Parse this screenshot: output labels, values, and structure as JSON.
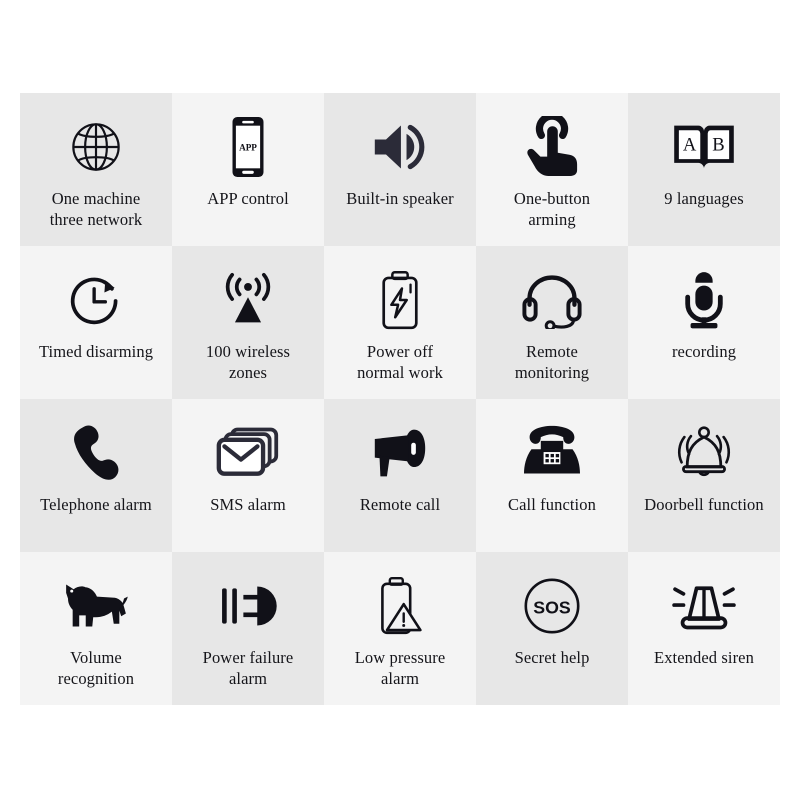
{
  "page": {
    "background_color": "#ffffff",
    "grid_shade_a": "#e7e7e7",
    "grid_shade_b": "#f4f4f4",
    "icon_color": "#111118",
    "text_color": "#15151a",
    "columns": 5,
    "rows": 4
  },
  "features": [
    {
      "label": "One machine\nthree network",
      "icon": "globe-icon"
    },
    {
      "label": "APP control",
      "icon": "smartphone-app-icon",
      "icon_text": "APP"
    },
    {
      "label": "Built-in speaker",
      "icon": "speaker-volume-icon"
    },
    {
      "label": "One-button\narming",
      "icon": "finger-tap-button-icon"
    },
    {
      "label": "9 languages",
      "icon": "open-book-icon",
      "icon_text": "A B"
    },
    {
      "label": "Timed disarming",
      "icon": "clock-arrow-icon"
    },
    {
      "label": "100 wireless\nzones",
      "icon": "antenna-signal-icon"
    },
    {
      "label": "Power off\nnormal work",
      "icon": "battery-bolt-icon"
    },
    {
      "label": "Remote\nmonitoring",
      "icon": "headset-icon"
    },
    {
      "label": "recording",
      "icon": "microphone-icon"
    },
    {
      "label": "Telephone alarm",
      "icon": "phone-handset-icon"
    },
    {
      "label": "SMS alarm",
      "icon": "envelope-stack-icon"
    },
    {
      "label": "Remote call",
      "icon": "megaphone-icon"
    },
    {
      "label": "Call function",
      "icon": "desk-telephone-icon"
    },
    {
      "label": "Doorbell function",
      "icon": "ringing-bell-icon"
    },
    {
      "label": "Volume\nrecognition",
      "icon": "dog-icon"
    },
    {
      "label": "Power failure\nalarm",
      "icon": "unplugged-plug-icon"
    },
    {
      "label": "Low pressure\nalarm",
      "icon": "battery-warning-icon"
    },
    {
      "label": "Secret help",
      "icon": "sos-circle-icon",
      "icon_text": "SOS"
    },
    {
      "label": "Extended siren",
      "icon": "siren-light-icon"
    }
  ]
}
